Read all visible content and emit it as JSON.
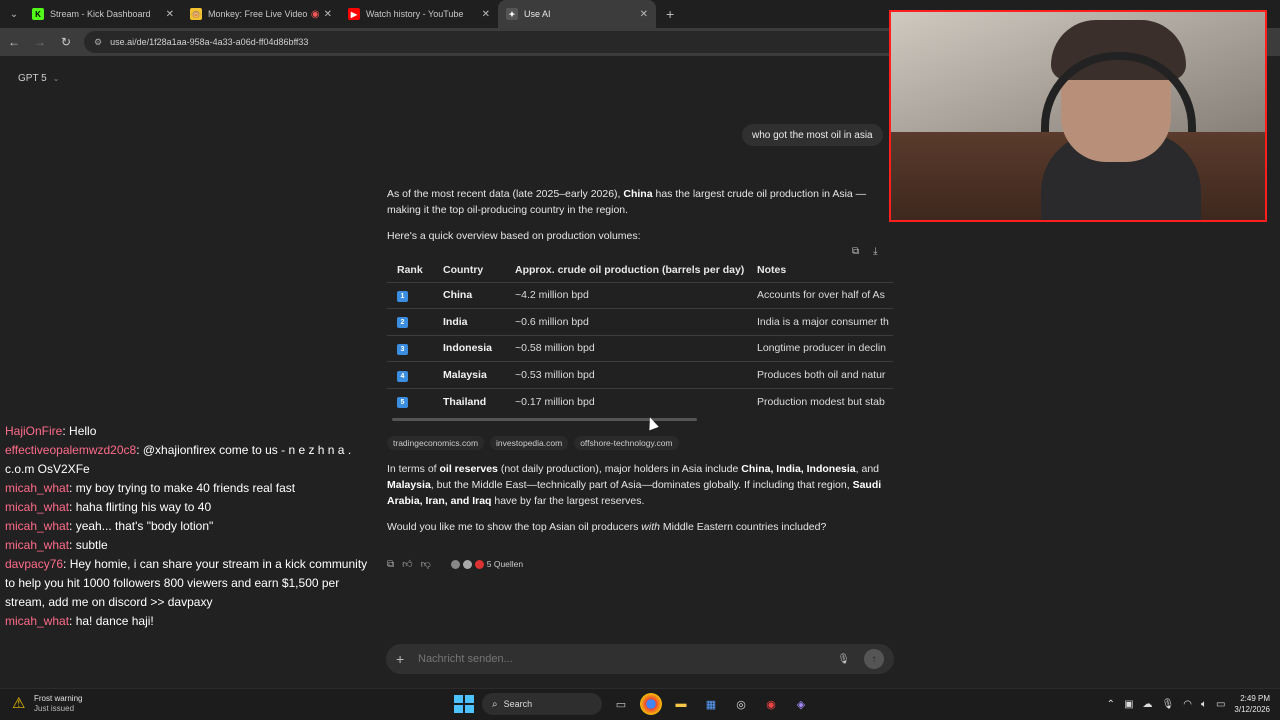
{
  "browser": {
    "tabs": [
      {
        "label": "Stream - Kick Dashboard",
        "favicon": "K",
        "favicon_color": "#53fc18"
      },
      {
        "label": "Monkey: Free Live Video Ch",
        "favicon": "🐵",
        "favicon_color": "#f2c230"
      },
      {
        "label": "Watch history - YouTube",
        "favicon": "▶",
        "favicon_color": "#ff0000"
      },
      {
        "label": "Use AI",
        "favicon": "✦",
        "favicon_color": "#888888"
      }
    ],
    "url": "use.ai/de/1f28a1aa-958a-4a33-a06d-ff04d86bff33"
  },
  "model": {
    "label": "GPT 5"
  },
  "conversation": {
    "user_message": "who got the most oil in asia",
    "intro_html_parts": {
      "p1_a": "As of the most recent data (late 2025–early 2026), ",
      "p1_b": "China",
      "p1_c": " has the largest crude oil production in Asia — making it the top oil-producing country in the region.",
      "p2": "Here's a quick overview based on production volumes:"
    },
    "table": {
      "headers": [
        "Rank",
        "Country",
        "Approx. crude oil production (barrels per day)",
        "Notes"
      ],
      "rows": [
        {
          "rank": "1",
          "country": "China",
          "production": "~4.2 million bpd",
          "notes": "Accounts for over half of As"
        },
        {
          "rank": "2",
          "country": "India",
          "production": "~0.6 million bpd",
          "notes": "India is a major consumer th"
        },
        {
          "rank": "3",
          "country": "Indonesia",
          "production": "~0.58 million bpd",
          "notes": "Longtime producer in declin"
        },
        {
          "rank": "4",
          "country": "Malaysia",
          "production": "~0.53 million bpd",
          "notes": "Produces both oil and natur"
        },
        {
          "rank": "5",
          "country": "Thailand",
          "production": "~0.17 million bpd",
          "notes": "Production modest but stab"
        }
      ]
    },
    "sources": [
      "tradingeconomics.com",
      "investopedia.com",
      "offshore-technology.com"
    ],
    "reserves": {
      "a": "In terms of ",
      "b": "oil reserves",
      "c": " (not daily production), major holders in Asia include ",
      "d": "China, India, Indonesia",
      "e": ", and ",
      "f": "Malaysia",
      "g": ", but the Middle East—technically part of Asia—dominates globally. If including that region, ",
      "h": "Saudi Arabia, Iran, and Iraq",
      "i": " have by far the largest reserves."
    },
    "followup": {
      "a": "Would you like me to show the top Asian oil producers ",
      "b": "with",
      "c": " Middle Eastern countries included?"
    },
    "source_count": "5 Quellen"
  },
  "composer": {
    "placeholder": "Nachricht senden..."
  },
  "chat": [
    {
      "user": "HajiOnFire",
      "color": "#ff6b8a",
      "text": "Hello"
    },
    {
      "user": "effectiveopalemwzd20c8",
      "color": "#ff6b8a",
      "text": "@xhajionfirex come to us - n e z h n a . c.o.m OsV2XFe"
    },
    {
      "user": "micah_what",
      "color": "#ff6b8a",
      "text": "my boy trying to make 40 friends real fast"
    },
    {
      "user": "micah_what",
      "color": "#ff6b8a",
      "text": "haha flirting his way to 40"
    },
    {
      "user": "micah_what",
      "color": "#ff6b8a",
      "text": "yeah... that's \"body lotion\""
    },
    {
      "user": "micah_what",
      "color": "#ff6b8a",
      "text": "subtle"
    },
    {
      "user": "davpacy76",
      "color": "#ff6b8a",
      "text": "Hey homie, i can share your stream in a kick community to help you hit 1000 followers 800 viewers and earn $1,500 per stream, add me on discord >> davpaxy"
    },
    {
      "user": "micah_what",
      "color": "#ff6b8a",
      "text": "ha! dance haji!"
    }
  ],
  "taskbar": {
    "weather_title": "Frost warning",
    "weather_sub": "Just issued",
    "search_label": "Search",
    "time": "2:49 PM",
    "date": "3/12/2026"
  }
}
